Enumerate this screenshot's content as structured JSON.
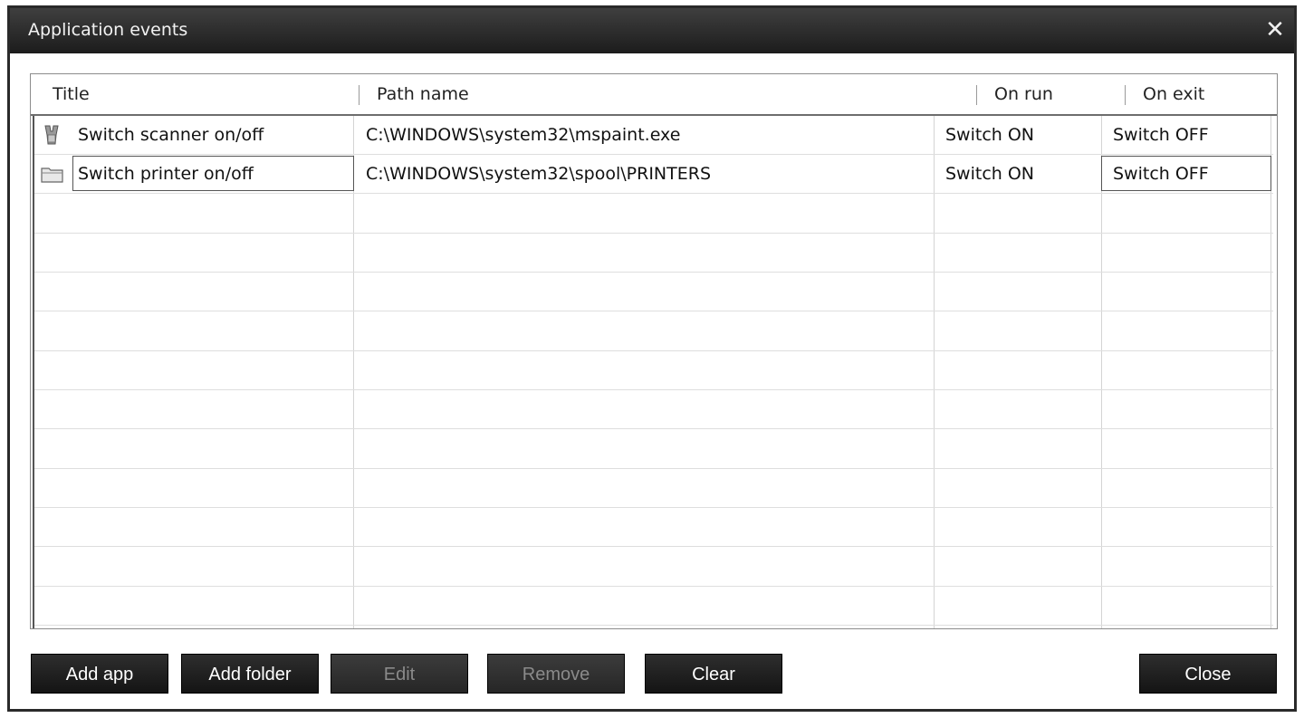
{
  "window": {
    "title": "Application events",
    "close_glyph": "✕"
  },
  "list": {
    "columns": [
      "Title",
      "Path name",
      "On run",
      "On exit"
    ],
    "rows": [
      {
        "icon": "scanner-icon",
        "title": "Switch scanner on/off",
        "path": "C:\\WINDOWS\\system32\\mspaint.exe",
        "on_run": "Switch ON",
        "on_exit": "Switch OFF"
      },
      {
        "icon": "folder-icon",
        "title": "Switch printer on/off",
        "path": "C:\\WINDOWS\\system32\\spool\\PRINTERS",
        "on_run": "Switch ON",
        "on_exit": "Switch OFF"
      }
    ]
  },
  "buttons": {
    "add_app": "Add app",
    "add_folder": "Add folder",
    "edit": "Edit",
    "remove": "Remove",
    "clear": "Clear",
    "close": "Close"
  }
}
